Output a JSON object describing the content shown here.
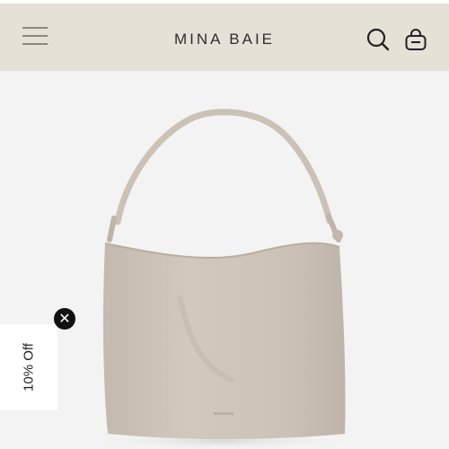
{
  "header": {
    "brand": "MINA BAIE",
    "icons": {
      "menu": "hamburger-menu-icon",
      "search": "search-icon",
      "bag": "shopping-bag-icon"
    }
  },
  "promo": {
    "label": "10% Off",
    "close_icon": "✕"
  },
  "colors": {
    "header_bg": "#e6e1d7",
    "hero_bg": "#f3f3f3",
    "bag_color": "#cdc3b8"
  }
}
